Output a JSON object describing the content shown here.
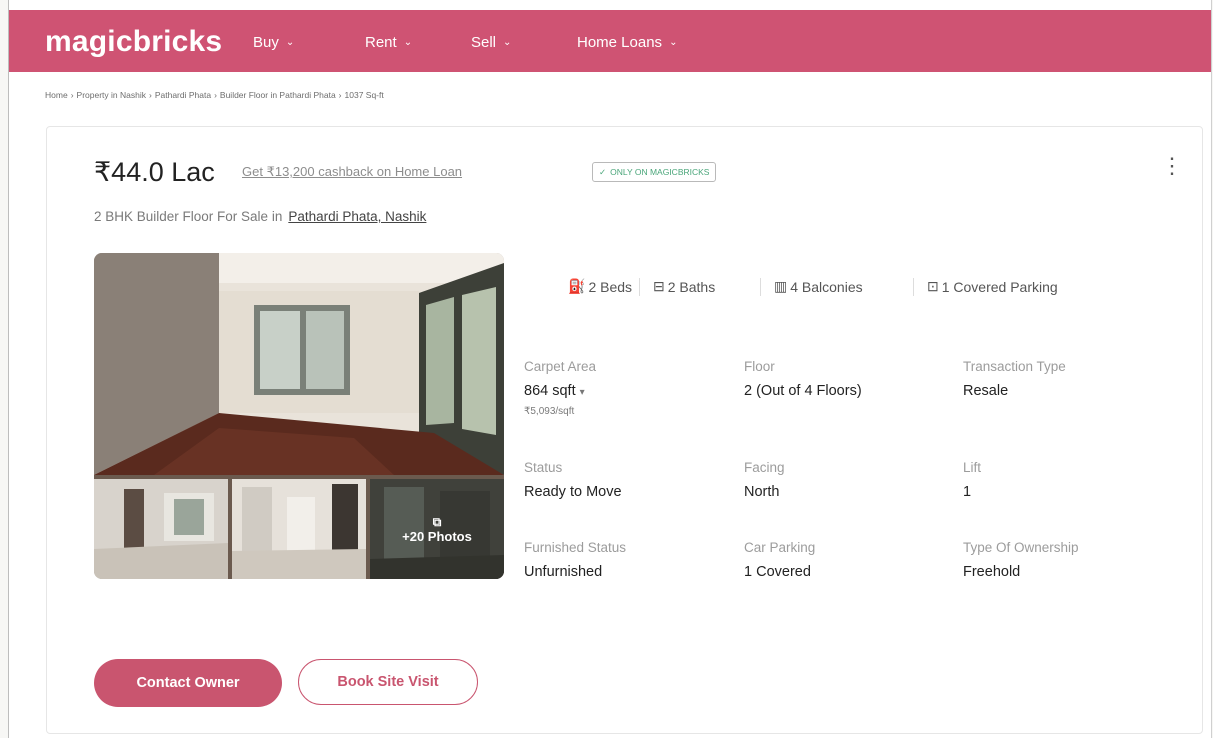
{
  "header": {
    "logo": "magicbricks",
    "nav": [
      {
        "label": "Buy"
      },
      {
        "label": "Rent"
      },
      {
        "label": "Sell"
      },
      {
        "label": "Home Loans"
      }
    ]
  },
  "breadcrumb": [
    "Home",
    "Property in Nashik",
    "Pathardi Phata",
    "Builder Floor in Pathardi Phata",
    "1037 Sq-ft"
  ],
  "listing": {
    "price": "₹44.0 Lac",
    "cashback_link": "Get ₹13,200 cashback on Home Loan",
    "badge": "ONLY ON MAGICBRICKS",
    "subtitle": "2 BHK Builder Floor For Sale in",
    "location": "Pathardi Phata, Nashik",
    "photo_count": "+20 Photos",
    "amenities": [
      {
        "label": "2 Beds",
        "icon": "bed-icon"
      },
      {
        "label": "2 Baths",
        "icon": "bath-icon"
      },
      {
        "label": "4 Balconies",
        "icon": "balcony-icon"
      },
      {
        "label": "1 Covered Parking",
        "icon": "car-icon"
      }
    ],
    "details": [
      {
        "label": "Carpet Area",
        "value": "864 sqft",
        "sub": "₹5,093/sqft"
      },
      {
        "label": "Floor",
        "value": "2 (Out of 4 Floors)"
      },
      {
        "label": "Transaction Type",
        "value": "Resale"
      },
      {
        "label": "Status",
        "value": "Ready to Move"
      },
      {
        "label": "Facing",
        "value": "North"
      },
      {
        "label": "Lift",
        "value": "1"
      },
      {
        "label": "Furnished Status",
        "value": "Unfurnished"
      },
      {
        "label": "Car Parking",
        "value": "1 Covered"
      },
      {
        "label": "Type Of Ownership",
        "value": "Freehold"
      }
    ]
  },
  "actions": {
    "contact": "Contact Owner",
    "visit": "Book Site Visit"
  },
  "colors": {
    "brand": "#cf5373",
    "button": "#c9556f",
    "badge_text": "#4aa67a"
  }
}
